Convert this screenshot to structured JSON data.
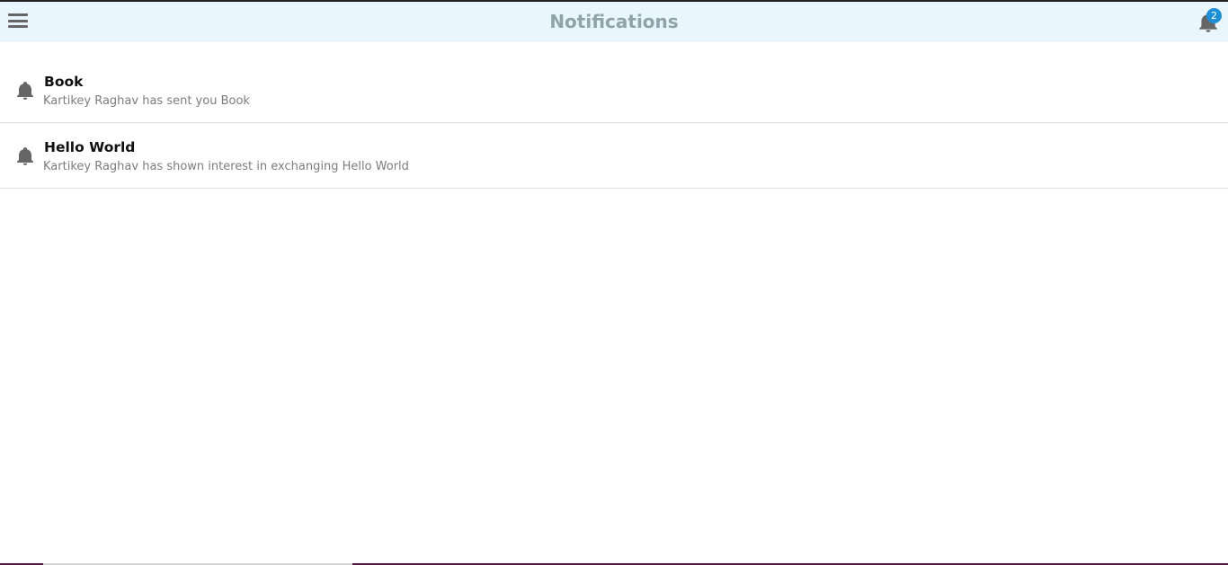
{
  "header": {
    "title": "Notifications",
    "menu_icon": "hamburger-menu-icon",
    "notification_icon": "bell-icon",
    "notification_count": "2",
    "background": "#e9f6fd",
    "title_color": "#8fa3a9",
    "badge_color": "#1e8fd6"
  },
  "notifications": [
    {
      "icon": "bell-icon",
      "title": "Book",
      "message": "Kartikey Raghav has sent you Book"
    },
    {
      "icon": "bell-icon",
      "title": "Hello World",
      "message": "Kartikey Raghav has shown interest in exchanging Hello World"
    }
  ]
}
